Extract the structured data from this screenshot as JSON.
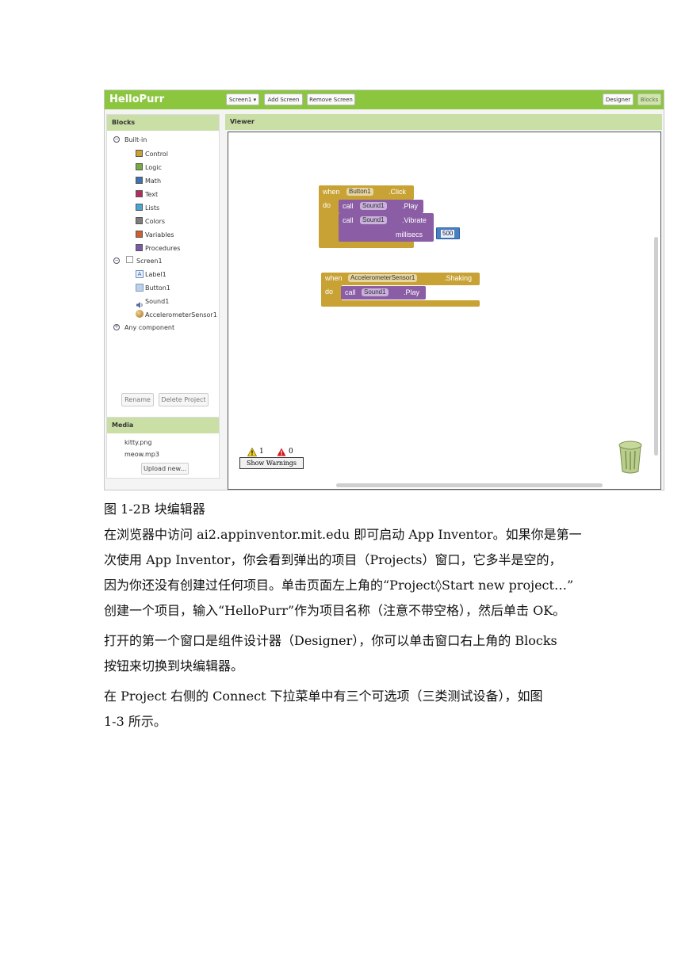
{
  "app": {
    "title": "HelloPurr",
    "screen_select": "Screen1 ▾",
    "add_screen": "Add Screen",
    "remove_screen": "Remove Screen",
    "designer": "Designer",
    "blocks": "Blocks"
  },
  "blocks_panel": {
    "header": "Blocks",
    "builtin": "Built-in",
    "builtin_items": [
      {
        "label": "Control",
        "color": "#c8a234"
      },
      {
        "label": "Logic",
        "color": "#77ab41"
      },
      {
        "label": "Math",
        "color": "#3f71b5"
      },
      {
        "label": "Text",
        "color": "#b32d5e"
      },
      {
        "label": "Lists",
        "color": "#49a6d4"
      },
      {
        "label": "Colors",
        "color": "#7d7d7d"
      },
      {
        "label": "Variables",
        "color": "#d05f2d"
      },
      {
        "label": "Procedures",
        "color": "#7c5ba6"
      }
    ],
    "screen": "Screen1",
    "components": [
      "Label1",
      "Button1",
      "Sound1",
      "AccelerometerSensor1"
    ],
    "any_component": "Any component",
    "rename": "Rename",
    "delete_project": "Delete Project"
  },
  "media_panel": {
    "header": "Media",
    "files": [
      "kitty.png",
      "meow.mp3"
    ],
    "upload": "Upload new..."
  },
  "viewer": {
    "header": "Viewer",
    "block1": {
      "when": "when",
      "component": "Button1",
      "event": ".Click",
      "do": "do",
      "call1": "call",
      "sound1": "Sound1",
      "play": ".Play",
      "call2": "call",
      "sound2": "Sound1",
      "vibrate": ".Vibrate",
      "millisecs": "millisecs",
      "value": "500"
    },
    "block2": {
      "when": "when",
      "component": "AccelerometerSensor1",
      "event": ".Shaking",
      "do": "do",
      "call": "call",
      "sound": "Sound1",
      "play": ".Play"
    },
    "warnings_count": "1",
    "errors_count": "0",
    "show_warnings": "Show Warnings"
  },
  "document": {
    "caption": "图  1-2B  块编辑器",
    "para1_lines": [
      "在浏览器中访问 ai2.appinventor.mit.edu 即可启动 App Inventor。如果你是第一",
      "次使用 App Inventor，你会看到弹出的项目（Projects）窗口，它多半是空的，",
      "因为你还没有创建过任何项目。单击页面左上角的“Project◊Start new project…”",
      "创建一个项目，输入“HelloPurr”作为项目名称（注意不带空格），然后单击 OK。"
    ],
    "para2_lines": [
      "打开的第一个窗口是组件设计器（Designer），你可以单击窗口右上角的 Blocks",
      "按钮来切换到块编辑器。"
    ],
    "para3_lines": [
      "在 Project 右侧的 Connect 下拉菜单中有三个可选项（三类测试设备），如图",
      "1-3 所示。"
    ]
  }
}
